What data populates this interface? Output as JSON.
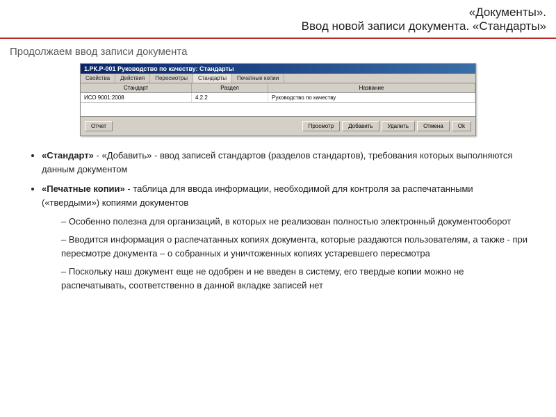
{
  "header": {
    "line1": "«Документы».",
    "line2": "Ввод новой записи документа. «Стандарты»"
  },
  "subtitle": "Продолжаем ввод записи документа",
  "window": {
    "title": "1.РК.Р-001 Руководство по качеству: Стандарты",
    "tabs": [
      "Свойства",
      "Действия",
      "Пересмотры",
      "Стандарты",
      "Печатные копии"
    ],
    "active_tab": 3,
    "columns": {
      "standard": "Стандарт",
      "section": "Раздел",
      "name": "Название"
    },
    "rows": [
      {
        "standard": "ИСО 9001:2008",
        "section": "4.2.2",
        "name": "Руководство по качеству"
      }
    ],
    "buttons": {
      "left": [
        "Отчет"
      ],
      "right": [
        "Просмотр",
        "Добавить",
        "Удалить",
        "Отмена",
        "Ok"
      ]
    }
  },
  "body": {
    "items": [
      {
        "strong": "«Стандарт»",
        "rest": " - «Добавить» - ввод записей стандартов (разделов стандартов), требования которых выполняются данным документом"
      },
      {
        "strong": "«Печатные копии»",
        "rest": " - таблица для ввода информации, необходимой для контроля за распечатанными («твердыми») копиями документов",
        "sub": [
          "Особенно полезна для организаций, в которых не реализован полностью электронный документооборот",
          "Вводится информация о распечатанных копиях документа, которые раздаются пользователям, а также  - при пересмотре документа – о собранных и уничтоженных копиях устаревшего пересмотра",
          "Поскольку наш документ еще не одобрен и не введен в систему, его твердые копии можно не распечатывать, соответственно в данной вкладке записей нет"
        ]
      }
    ]
  }
}
